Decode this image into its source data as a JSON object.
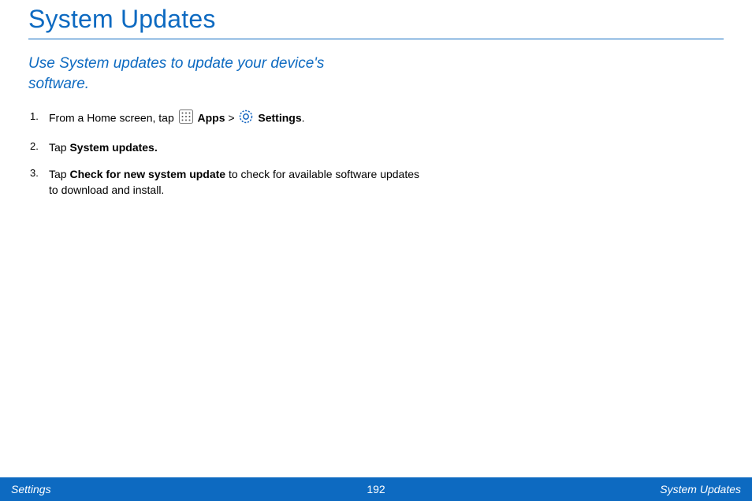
{
  "title": "System Updates",
  "subtitle": "Use System updates to update your device's software.",
  "steps": {
    "s1": {
      "t1": "From a Home screen, tap ",
      "apps": "Apps",
      "gt": " > ",
      "settings": "Settings",
      "end": "."
    },
    "s2": {
      "t1": "Tap ",
      "bold": "System updates."
    },
    "s3": {
      "t1": "Tap ",
      "bold": "Check for new system update",
      "t2": " to check for available software updates to download and install."
    }
  },
  "footer": {
    "left": "Settings",
    "center": "192",
    "right": "System Updates"
  }
}
